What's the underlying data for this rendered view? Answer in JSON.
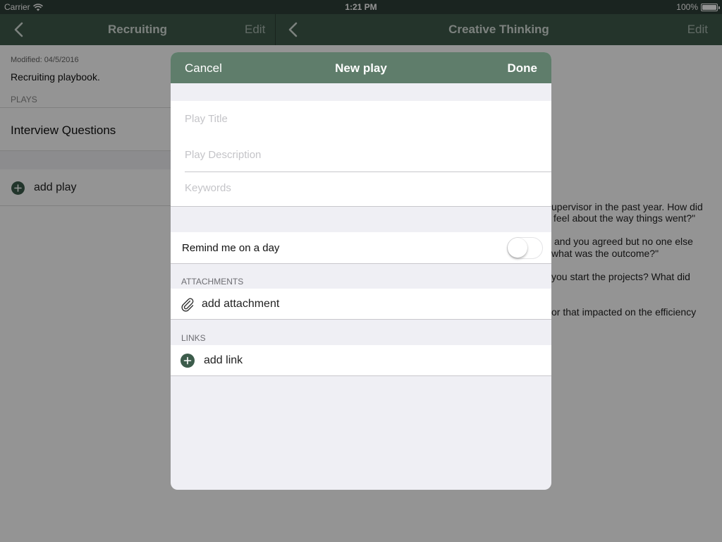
{
  "statusbar": {
    "carrier": "Carrier",
    "time": "1:21 PM",
    "battery": "100%"
  },
  "master": {
    "nav": {
      "title": "Recruiting",
      "edit_label": "Edit"
    },
    "modified": "Modified: 04/5/2016",
    "description": "Recruiting playbook.",
    "plays_header": "PLAYS",
    "plays": [
      {
        "label": "Interview Questions"
      }
    ],
    "add_play_label": "add play"
  },
  "detail": {
    "nav": {
      "title": "Creative Thinking",
      "edit_label": "Edit"
    },
    "lines": [
      "upervisor in the past year. How did",
      "feel about the way things went?\"",
      "and you agreed but no one else",
      "what was the outcome?\"",
      "you start the projects? What did",
      "or that impacted on the efficiency"
    ]
  },
  "modal": {
    "cancel_label": "Cancel",
    "title": "New play",
    "done_label": "Done",
    "fields": {
      "title_placeholder": "Play Title",
      "title_value": "",
      "description_placeholder": "Play Description",
      "description_value": "",
      "keywords_placeholder": "Keywords",
      "keywords_value": ""
    },
    "remind_label": "Remind me on a day",
    "remind_on": false,
    "attachments_header": "ATTACHMENTS",
    "add_attachment_label": "add attachment",
    "links_header": "LINKS",
    "add_link_label": "add link"
  },
  "icons": {
    "back": "chevron-left-icon",
    "wifi": "wifi-icon",
    "battery": "battery-icon",
    "add": "plus-circle-icon",
    "attach": "paperclip-icon"
  },
  "colors": {
    "navbar": "#3e5a4b",
    "modal_header": "#5f7d6b",
    "accent": "#3c5c4b",
    "group_background": "#efeff4"
  }
}
